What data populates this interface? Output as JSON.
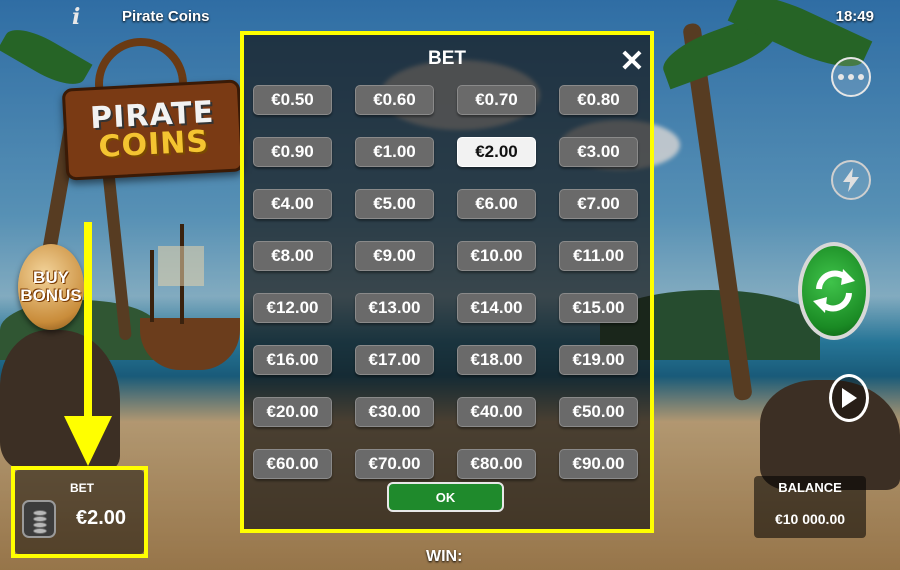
{
  "topbar": {
    "title": "Pirate Coins",
    "time": "18:49",
    "info_icon": "i"
  },
  "logo": {
    "line1": "PIRATE",
    "line2": "COINS"
  },
  "buy_bonus": {
    "line1": "BUY",
    "line2": "BONUS"
  },
  "bet_panel": {
    "label": "BET",
    "value": "€2.00",
    "icon": "coin-stack-icon"
  },
  "balance_panel": {
    "label": "BALANCE",
    "value": "€10 000.00"
  },
  "win": {
    "label": "WIN:"
  },
  "modal": {
    "title": "BET",
    "close_label": "✕",
    "ok_label": "OK",
    "selected": "€2.00",
    "options": [
      "€0.50",
      "€0.60",
      "€0.70",
      "€0.80",
      "€0.90",
      "€1.00",
      "€2.00",
      "€3.00",
      "€4.00",
      "€5.00",
      "€6.00",
      "€7.00",
      "€8.00",
      "€9.00",
      "€10.00",
      "€11.00",
      "€12.00",
      "€13.00",
      "€14.00",
      "€15.00",
      "€16.00",
      "€17.00",
      "€18.00",
      "€19.00",
      "€20.00",
      "€30.00",
      "€40.00",
      "€50.00",
      "€60.00",
      "€70.00",
      "€80.00",
      "€90.00"
    ]
  },
  "controls": {
    "more_icon": "more-dots-icon",
    "turbo_icon": "lightning-icon",
    "spin_icon": "spin-arrows-icon",
    "autoplay_icon": "play-icon"
  },
  "colors": {
    "annotation": "#ffff00",
    "spin_green": "#1a8a24",
    "ok_green": "#1f8a2c",
    "option_grey": "#6a6a6a",
    "option_selected": "#f2f2f2"
  }
}
